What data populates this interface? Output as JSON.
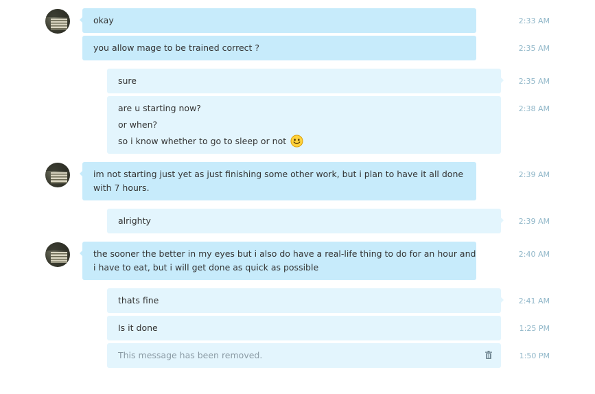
{
  "messages": [
    {
      "side": "in",
      "lines": [
        "okay"
      ],
      "time": "2:33 AM"
    },
    {
      "side": "in",
      "lines": [
        "you allow mage to be trained correct ?"
      ],
      "time": "2:35 AM"
    },
    {
      "side": "out",
      "lines": [
        "sure"
      ],
      "time": "2:35 AM"
    },
    {
      "side": "out",
      "lines": [
        "are u starting now?",
        "or when?",
        "so i know whether to go to sleep or not"
      ],
      "emoticon": "smile-emoticon",
      "time": "2:38 AM"
    },
    {
      "side": "in",
      "lines": [
        "im not starting just yet as just finishing some other work, but i plan to have it all done",
        "with 7 hours."
      ],
      "time": "2:39 AM"
    },
    {
      "side": "out",
      "lines": [
        "alrighty"
      ],
      "time": "2:39 AM"
    },
    {
      "side": "in",
      "lines": [
        "the sooner the better in my eyes but i also do have a real-life thing to do for an hour and",
        "i have to eat, but i will get done as quick as possible"
      ],
      "time": "2:40 AM"
    },
    {
      "side": "out",
      "lines": [
        "thats fine"
      ],
      "time": "2:41 AM"
    },
    {
      "side": "out",
      "lines": [
        "Is it done"
      ],
      "time": "1:25 PM"
    },
    {
      "side": "out",
      "lines": [
        "This message has been removed."
      ],
      "removed": true,
      "icon": "trash-icon",
      "time": "1:50 PM"
    }
  ],
  "colors": {
    "incoming_bubble": "#c7ebfb",
    "outgoing_bubble": "#e3f5fd",
    "timestamp": "#8fb6c8",
    "text": "#333333"
  }
}
